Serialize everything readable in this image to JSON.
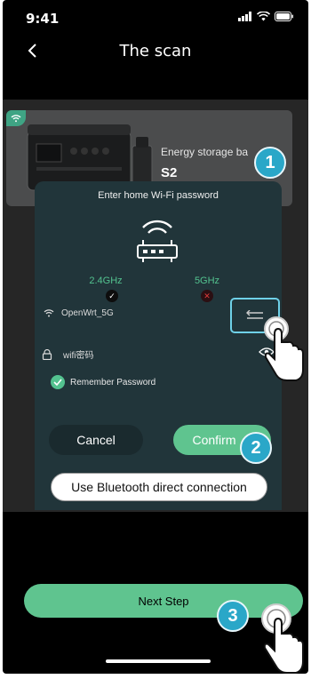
{
  "status": {
    "time": "9:41"
  },
  "nav": {
    "title": "The scan"
  },
  "device": {
    "name_label": "Energy storage ba",
    "model": "S2"
  },
  "modal": {
    "title": "Enter home Wi-Fi password",
    "band_24": "2.4GHz",
    "band_5": "5GHz",
    "ssid": "OpenWrt_5G",
    "password_placeholder": "wifi密码",
    "remember": "Remember Password",
    "cancel": "Cancel",
    "confirm": "Confirm",
    "bluetooth": "Use Bluetooth direct connection"
  },
  "next_step": "Next Step",
  "steps": [
    "1",
    "2",
    "3"
  ],
  "colors": {
    "accent": "#5fc48f",
    "badge": "#2aa7c8",
    "modal_bg": "#21353a"
  },
  "icons": [
    "chevron-left-icon",
    "signal-icon",
    "wifi-icon",
    "battery-icon",
    "router-icon",
    "check-icon",
    "close-icon",
    "swap-icon",
    "lock-icon",
    "eye-icon",
    "hand-pointer-icon"
  ]
}
